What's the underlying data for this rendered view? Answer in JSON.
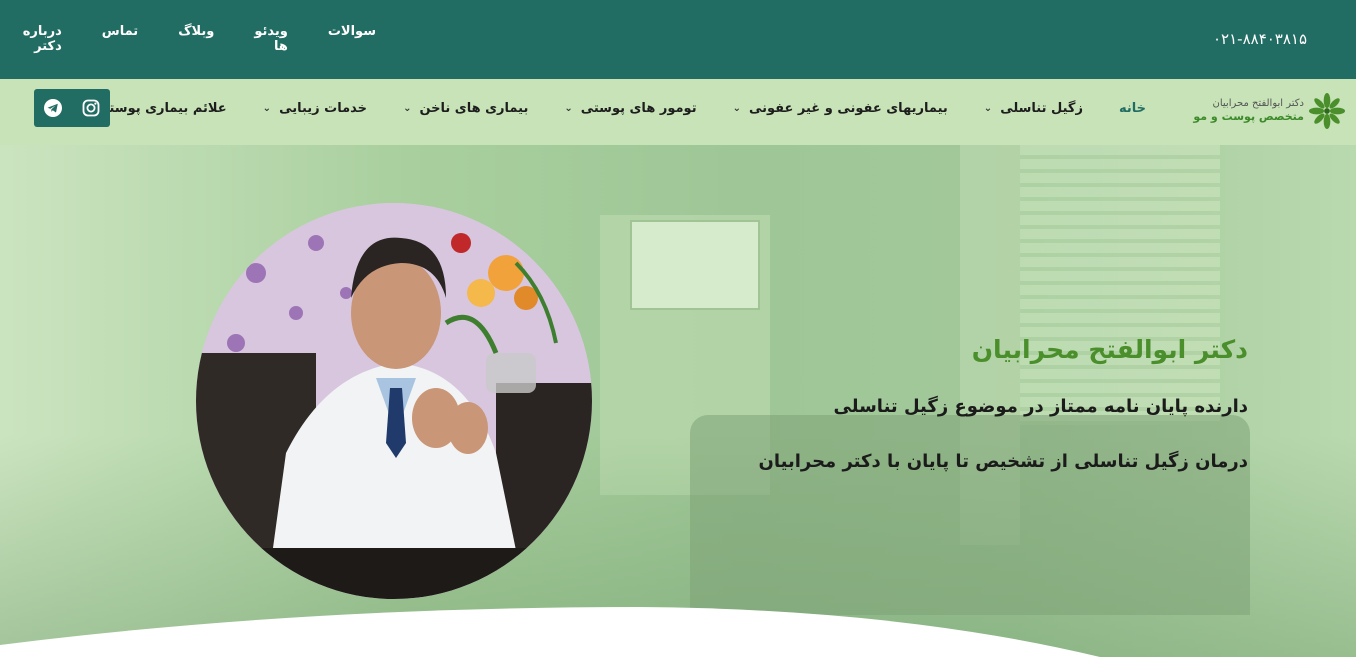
{
  "topbar": {
    "phone": "۰۲۱-۸۸۴۰۳۸۱۵",
    "links": [
      {
        "label": "درباره دکتر"
      },
      {
        "label": "تماس"
      },
      {
        "label": "وبلاگ"
      },
      {
        "label": "ویدئو ها"
      },
      {
        "label": "سوالات"
      }
    ]
  },
  "logo": {
    "line1": "دکتر ابوالفتح محرابیان",
    "line2": "متخصص پوست و مو"
  },
  "nav": {
    "items": [
      {
        "label": "خانه",
        "dropdown": false
      },
      {
        "label": "زگیل تناسلی",
        "dropdown": true
      },
      {
        "label": "بیماریهای عفونی و غیر عفونی",
        "dropdown": true
      },
      {
        "label": "تومور های پوستی",
        "dropdown": true
      },
      {
        "label": "بیماری های ناخن",
        "dropdown": true
      },
      {
        "label": "خدمات زیبایی",
        "dropdown": true
      },
      {
        "label": "علائم بیماری پوستی",
        "dropdown": true
      }
    ],
    "social": [
      "instagram-icon",
      "telegram-icon"
    ]
  },
  "hero": {
    "title": "دکتر ابوالفتح محرابیان",
    "line1": "دارنده پایان نامه ممتاز در موضوع زگیل تناسلی",
    "line2": "درمان زگیل تناسلی از تشخیص تا پایان با دکتر محرابیان"
  },
  "colors": {
    "primary": "#216c63",
    "nav_bg": "#c7e3b7",
    "accent": "#4a8f2b"
  }
}
